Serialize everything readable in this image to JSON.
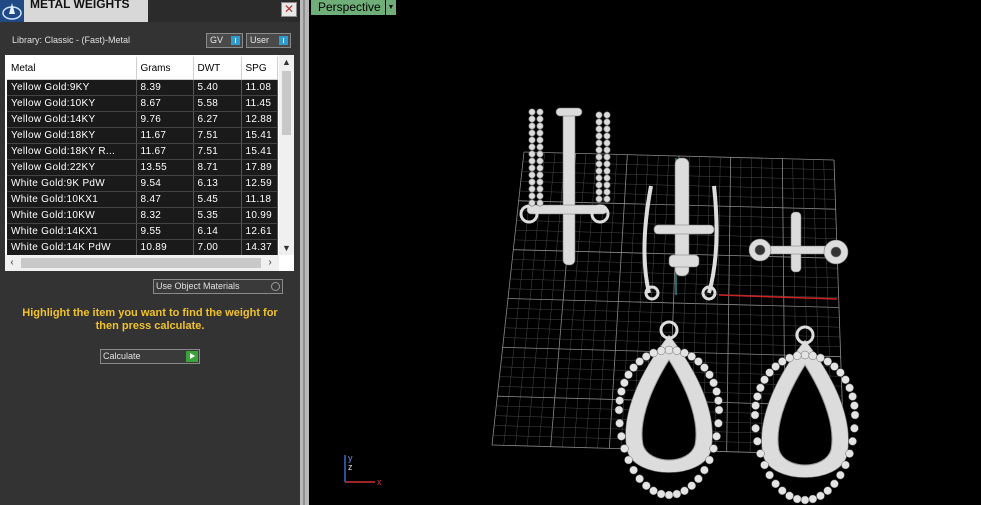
{
  "panel": {
    "title": "METAL WEIGHTS",
    "library_label": "Library: Classic - (Fast)-Metal",
    "toggle_gv": "GV",
    "toggle_user": "User",
    "columns": [
      "Metal",
      "Grams",
      "DWT",
      "SPG"
    ],
    "rows": [
      [
        "Yellow Gold:9KY",
        "8.39",
        "5.40",
        "11.08"
      ],
      [
        "Yellow Gold:10KY",
        "8.67",
        "5.58",
        "11.45"
      ],
      [
        "Yellow Gold:14KY",
        "9.76",
        "6.27",
        "12.88"
      ],
      [
        "Yellow Gold:18KY",
        "11.67",
        "7.51",
        "15.41"
      ],
      [
        "Yellow Gold:18KY R...",
        "11.67",
        "7.51",
        "15.41"
      ],
      [
        "Yellow Gold:22KY",
        "13.55",
        "8.71",
        "17.89"
      ],
      [
        "White Gold:9K PdW",
        "9.54",
        "6.13",
        "12.59"
      ],
      [
        "White Gold:10KX1",
        "8.47",
        "5.45",
        "11.18"
      ],
      [
        "White Gold:10KW",
        "8.32",
        "5.35",
        "10.99"
      ],
      [
        "White Gold:14KX1",
        "9.55",
        "6.14",
        "12.61"
      ],
      [
        "White Gold:14K PdW",
        "10.89",
        "7.00",
        "14.37"
      ]
    ],
    "use_object_materials": "Use Object Materials",
    "hint": "Highlight the item you want to find the weight for then press calculate.",
    "calculate_label": "Calculate"
  },
  "viewport": {
    "view_name": "Perspective",
    "axis_x": "x",
    "axis_y": "y",
    "axis_z": "z"
  },
  "colors": {
    "panel_bg": "#333333",
    "hint_text": "#f0c22c",
    "viewport_tab": "#6fae78",
    "grid": "#9a9a9a",
    "model": "#dcdcdc"
  }
}
